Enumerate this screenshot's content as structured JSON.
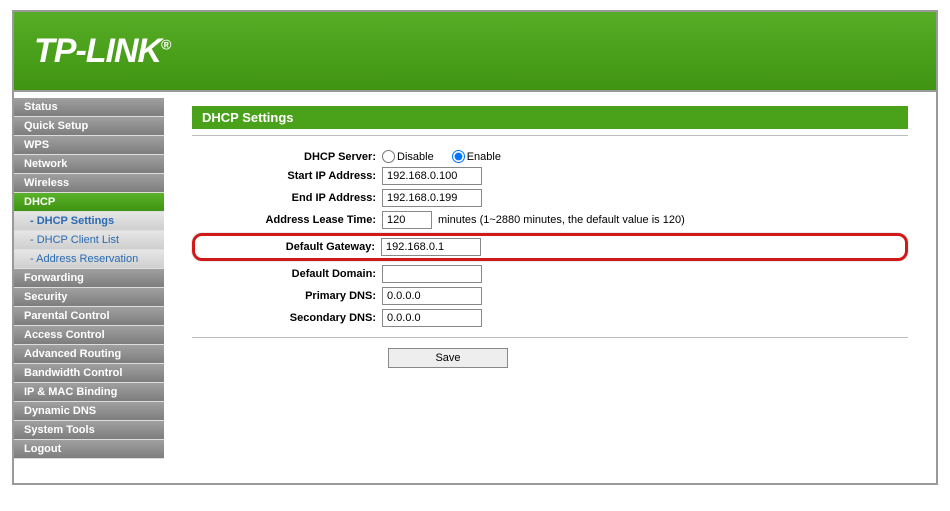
{
  "brand": "TP-LINK",
  "sidebar": {
    "items": [
      {
        "label": "Status"
      },
      {
        "label": "Quick Setup"
      },
      {
        "label": "WPS"
      },
      {
        "label": "Network"
      },
      {
        "label": "Wireless"
      },
      {
        "label": "DHCP",
        "active": true
      },
      {
        "label": "Forwarding"
      },
      {
        "label": "Security"
      },
      {
        "label": "Parental Control"
      },
      {
        "label": "Access Control"
      },
      {
        "label": "Advanced Routing"
      },
      {
        "label": "Bandwidth Control"
      },
      {
        "label": "IP & MAC Binding"
      },
      {
        "label": "Dynamic DNS"
      },
      {
        "label": "System Tools"
      },
      {
        "label": "Logout"
      }
    ],
    "subitems": [
      {
        "label": "- DHCP Settings",
        "active": true
      },
      {
        "label": "- DHCP Client List"
      },
      {
        "label": "- Address Reservation"
      }
    ]
  },
  "page": {
    "title": "DHCP Settings",
    "labels": {
      "dhcp_server": "DHCP Server:",
      "start_ip": "Start IP Address:",
      "end_ip": "End IP Address:",
      "lease_time": "Address Lease Time:",
      "gateway": "Default Gateway:",
      "domain": "Default Domain:",
      "primary_dns": "Primary DNS:",
      "secondary_dns": "Secondary DNS:"
    },
    "values": {
      "disable_label": "Disable",
      "enable_label": "Enable",
      "dhcp_enabled": "Enable",
      "start_ip": "192.168.0.100",
      "end_ip": "192.168.0.199",
      "lease_time": "120",
      "lease_hint": "minutes (1~2880 minutes, the default value is 120)",
      "gateway": "192.168.0.1",
      "domain": "",
      "primary_dns": "0.0.0.0",
      "secondary_dns": "0.0.0.0"
    },
    "save_label": "Save"
  }
}
